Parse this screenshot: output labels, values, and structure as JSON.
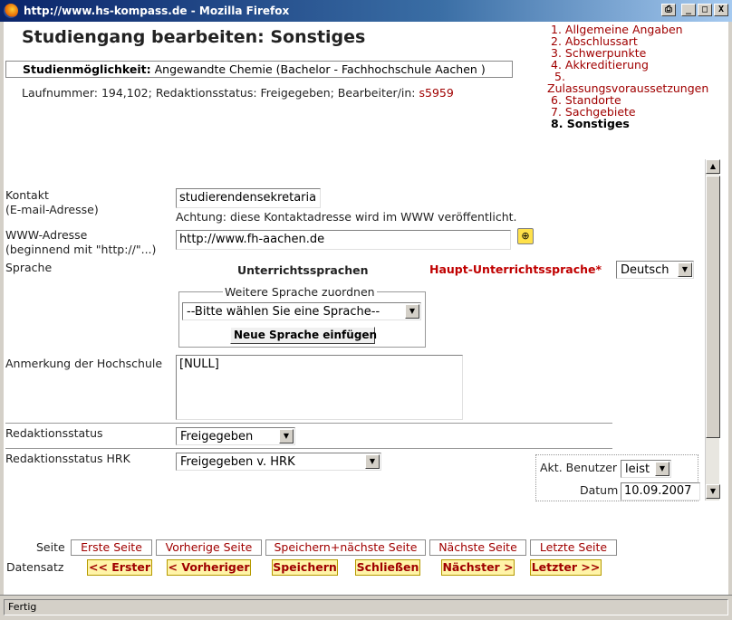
{
  "window": {
    "title": "http://www.hs-kompass.de - Mozilla Firefox",
    "buttons": {
      "print": "⎙",
      "minimize": "_",
      "maximize": "□",
      "close": "X"
    }
  },
  "page": {
    "title": "Studiengang bearbeiten: Sonstiges"
  },
  "nav": {
    "items": [
      "1. Allgemeine Angaben",
      "2. Abschlussart",
      "3. Schwerpunkte",
      "4. Akkreditierung",
      "5.",
      "Zulassungsvoraussetzungen",
      "6. Standorte",
      "7. Sachgebiete",
      "8. Sonstiges"
    ]
  },
  "studien": {
    "label": "Studienmöglichkeit:",
    "value": "Angewandte Chemie (Bachelor - Fachhochschule Aachen )"
  },
  "info": {
    "text": "Laufnummer: 194,102; Redaktionsstatus: Freigegeben; Bearbeiter/in:",
    "editor": "s5959"
  },
  "form": {
    "kontakt_label_1": "Kontakt",
    "kontakt_label_2": "(E-mail-Adresse)",
    "kontakt_value": "studierendensekretaria",
    "kontakt_note": "Achtung: diese Kontaktadresse wird im WWW veröffentlicht.",
    "www_label_1": "WWW-Adresse",
    "www_label_2": "(beginnend mit \"http://\"...)",
    "www_value": "http://www.fh-aachen.de",
    "sprache_label": "Sprache",
    "unterricht_heading": "Unterrichtssprachen",
    "haupt_label": "Haupt-Unterrichtssprache*",
    "haupt_value": "Deutsch",
    "weitere_label": "Weitere Sprache zuordnen",
    "weitere_select": "--Bitte wählen Sie eine Sprache--",
    "neue_sprache_btn": "Neue Sprache einfügen",
    "anmerkung_label": "Anmerkung der Hochschule",
    "anmerkung_value": "[NULL]",
    "redaktion_label": "Redaktionsstatus",
    "redaktion_value": "Freigegeben",
    "hrk_label": "Redaktionsstatus HRK",
    "hrk_value": "Freigegeben v. HRK"
  },
  "user": {
    "benutzer_label": "Akt. Benutzer",
    "benutzer_value": "leist",
    "datum_label": "Datum",
    "datum_value": "10.09.2007"
  },
  "pager": {
    "seite_label": "Seite",
    "seite_buttons": [
      "Erste Seite",
      "Vorherige Seite",
      "Speichern+nächste Seite",
      "Nächste Seite",
      "Letzte Seite"
    ],
    "datensatz_label": "Datensatz",
    "datensatz_buttons": [
      "<< Erster",
      "< Vorheriger",
      "Speichern",
      "Schließen",
      "Nächster >",
      "Letzter >>"
    ]
  },
  "status": {
    "text": "Fertig"
  },
  "colors": {
    "link_red": "#a00000",
    "title_blue": "#0a246a",
    "record_button_bg": "#fff4a8"
  }
}
